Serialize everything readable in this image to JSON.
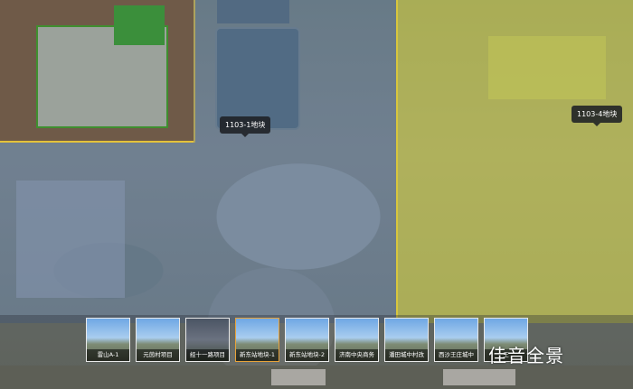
{
  "map": {
    "markers": [
      {
        "label": "1103-1地块"
      },
      {
        "label": "1103-4地块"
      }
    ],
    "zone_colors": {
      "blue": "#3c64aa",
      "yellow": "#cdcd3c",
      "border": "#e4c23a"
    }
  },
  "scenes": [
    {
      "label": "雷山A-1",
      "active": false
    },
    {
      "label": "元茵村项目",
      "active": false
    },
    {
      "label": "经十一路项目",
      "active": false
    },
    {
      "label": "新东站地块-1",
      "active": true
    },
    {
      "label": "新东站地块-2",
      "active": false
    },
    {
      "label": "济南中央商务",
      "active": false
    },
    {
      "label": "潘田城中村改",
      "active": false
    },
    {
      "label": "西沙王庄城中",
      "active": false
    },
    {
      "label": "王",
      "active": false
    }
  ],
  "brand": {
    "text": "佳音全景"
  }
}
